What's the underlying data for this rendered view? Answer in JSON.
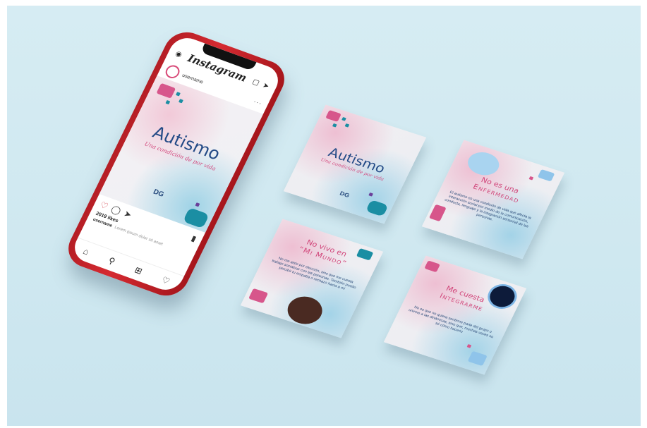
{
  "phone": {
    "app_name": "Instagram",
    "username": "username",
    "more_icon": "···",
    "post": {
      "title": "Autismo",
      "subtitle": "Una condición de por vida",
      "brand": "DG"
    },
    "likes": "2019 likes",
    "caption_user": "username",
    "caption_text": "Lorem ipsum dolor sit amet",
    "icons": {
      "camera": "camera-icon",
      "igtv": "igtv-icon",
      "send": "send-icon",
      "heart": "heart-icon",
      "comment": "comment-icon",
      "share": "share-icon",
      "bookmark": "bookmark-icon",
      "home": "home-icon",
      "search": "search-icon",
      "add": "add-icon",
      "activity": "activity-icon"
    }
  },
  "cards": [
    {
      "title": "Autismo",
      "subtitle": "Una condición de por vida",
      "brand": "DG"
    },
    {
      "heading_line1": "No es una",
      "heading_line2": "Enfermedad",
      "body": "El autismo es una condición de vida que afecta la interacción social por medio de la comunicación, conducta, lenguaje y la integración sensorial de las personas."
    },
    {
      "heading_line1": "No vivo en",
      "heading_line2": "“Mi Mundo”",
      "body": "No me aislo por elección, sino que me cuesta trabajo socializar con las personas. También puedo percibir tu empatía o rechazo hacia a mi"
    },
    {
      "heading_line1": "Me cuesta",
      "heading_line2": "Integrarme",
      "body": "No es que no quiera sentirme parte del grupo o unirme a las dinámicas, sino que, muchas veces no sé cómo hacerlo"
    }
  ],
  "colors": {
    "background": "#d6ecf3",
    "phone_red": "#c8232b",
    "title_blue": "#234a86",
    "accent_pink": "#d1467a",
    "puzzle_teal": "#1b8ea3"
  }
}
